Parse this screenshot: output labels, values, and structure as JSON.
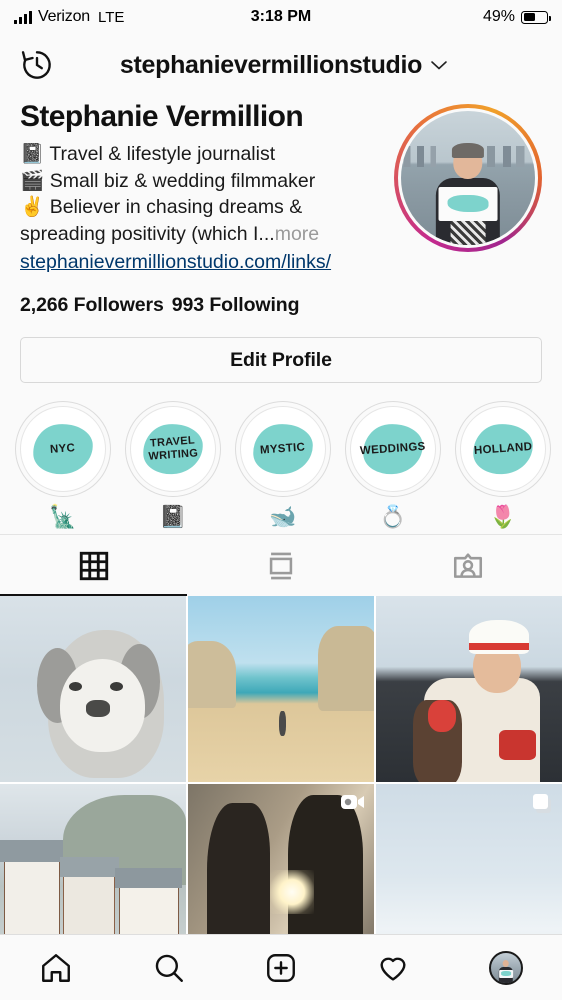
{
  "status_bar": {
    "carrier": "Verizon",
    "network": "LTE",
    "time": "3:18 PM",
    "battery_percent": "49%",
    "signal_icon": "signal-bars-icon",
    "battery_icon": "battery-icon"
  },
  "header": {
    "archive_icon": "clock-history-icon",
    "username": "stephanievermillionstudio",
    "chevron": "∨",
    "menu_icon": "hamburger-menu-icon"
  },
  "profile": {
    "full_name": "Stephanie Vermillion",
    "bio_lines": [
      "📓 Travel & lifestyle journalist",
      "🎬 Small biz & wedding filmmaker",
      "✌️ Believer in chasing dreams &",
      "spreading positivity (which I..."
    ],
    "bio_more": "more",
    "website": "stephanievermillionstudio.com/links/",
    "followers_count": "2,266",
    "followers_label": "Followers",
    "following_count": "993",
    "following_label": "Following",
    "avatar_name": "profile-avatar",
    "has_story_ring": true,
    "ring_colors": [
      "#a0268e",
      "#c32a8e",
      "#e8733b",
      "#f0a02a"
    ]
  },
  "actions": {
    "edit_profile_label": "Edit Profile"
  },
  "highlights": [
    {
      "label": "NYC",
      "emoji": "🗽",
      "cover_color": "#7dd3cc"
    },
    {
      "label": "TRAVEL WRITING",
      "label_line1": "TRAVEL",
      "label_line2": "WRITING",
      "emoji": "📓",
      "cover_color": "#7dd3cc"
    },
    {
      "label": "MYSTIC",
      "emoji": "🐋",
      "cover_color": "#7dd3cc"
    },
    {
      "label": "WEDDINGS",
      "emoji": "💍",
      "cover_color": "#7dd3cc"
    },
    {
      "label": "HOLLAND",
      "emoji": "🌷",
      "cover_color": "#7dd3cc"
    }
  ],
  "tabs": [
    {
      "name": "grid-tab",
      "icon": "grid-icon",
      "active": true
    },
    {
      "name": "list-tab",
      "icon": "feed-list-icon",
      "active": false
    },
    {
      "name": "tagged-tab",
      "icon": "tagged-person-icon",
      "active": false
    }
  ],
  "posts": [
    {
      "name": "post-dog-in-snow",
      "description": "gray and white poodle in snow",
      "badge": ""
    },
    {
      "name": "post-beach-cliffs",
      "description": "person walking on beach between cliffs",
      "badge": ""
    },
    {
      "name": "post-winter-portrait",
      "description": "woman in winter hat giving thumbs up",
      "badge": ""
    },
    {
      "name": "post-village-houses",
      "description": "half-timbered village houses in snow",
      "badge": ""
    },
    {
      "name": "post-wedding-couple",
      "description": "wedding couple kissing at sunset",
      "badge": "video-icon"
    },
    {
      "name": "post-sky-beach",
      "description": "pale beach and sky",
      "badge": "carousel-icon"
    }
  ],
  "bottom_nav": [
    {
      "name": "home-nav",
      "icon": "home-icon"
    },
    {
      "name": "search-nav",
      "icon": "search-icon"
    },
    {
      "name": "add-post-nav",
      "icon": "plus-square-icon"
    },
    {
      "name": "activity-nav",
      "icon": "heart-icon"
    },
    {
      "name": "profile-nav",
      "icon": "avatar-icon"
    }
  ],
  "colors": {
    "background": "#fafafa",
    "text": "#111111",
    "link": "#00376b",
    "muted": "#9a9a9a",
    "highlight_teal": "#7dd3cc"
  }
}
